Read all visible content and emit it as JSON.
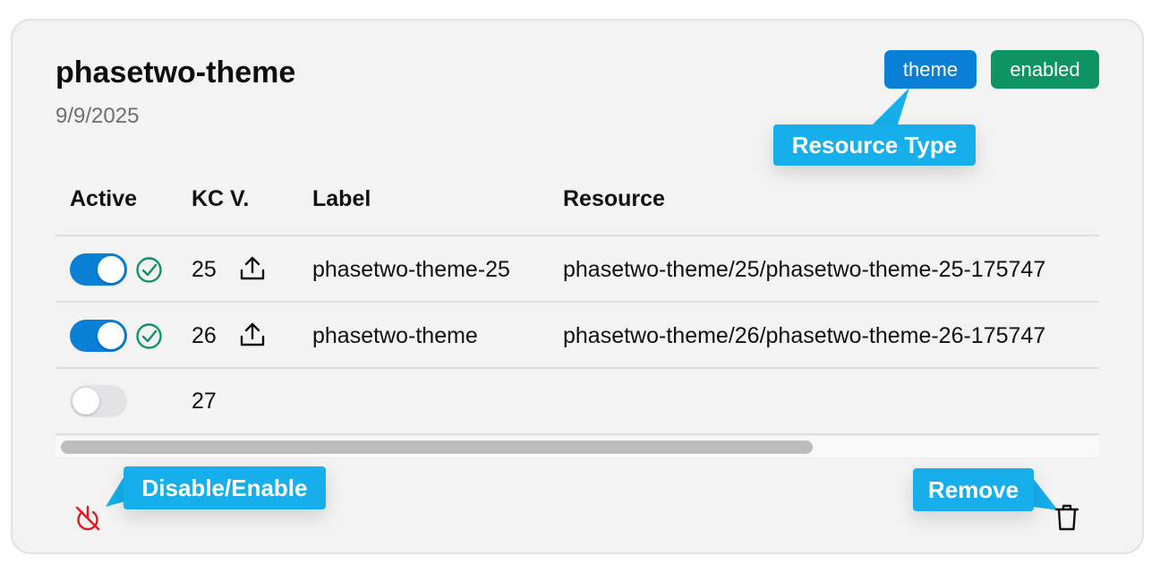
{
  "card": {
    "title": "phasetwo-theme",
    "date": "9/9/2025",
    "badges": [
      {
        "label": "theme",
        "color": "#0a7fd6"
      },
      {
        "label": "enabled",
        "color": "#0e9363"
      }
    ]
  },
  "table": {
    "headers": [
      "Active",
      "KC V.",
      "Label",
      "Resource"
    ],
    "rows": [
      {
        "active": true,
        "verified": true,
        "kc_version": "25",
        "has_upload": true,
        "label": "phasetwo-theme-25",
        "resource": "phasetwo-theme/25/phasetwo-theme-25-175747"
      },
      {
        "active": true,
        "verified": true,
        "kc_version": "26",
        "has_upload": true,
        "label": "phasetwo-theme",
        "resource": "phasetwo-theme/26/phasetwo-theme-26-175747"
      },
      {
        "active": false,
        "verified": false,
        "kc_version": "27",
        "has_upload": false,
        "label": "",
        "resource": ""
      }
    ]
  },
  "callouts": {
    "resource_type": "Resource Type",
    "disable_enable": "Disable/Enable",
    "remove": "Remove"
  },
  "colors": {
    "accent": "#0a7fd6",
    "callout": "#16aeeb",
    "success": "#0e9363",
    "danger": "#e0191f"
  },
  "icons": {
    "verified": "check-circle-icon",
    "upload": "upload-icon",
    "disable": "power-off-icon",
    "remove": "trash-icon"
  }
}
